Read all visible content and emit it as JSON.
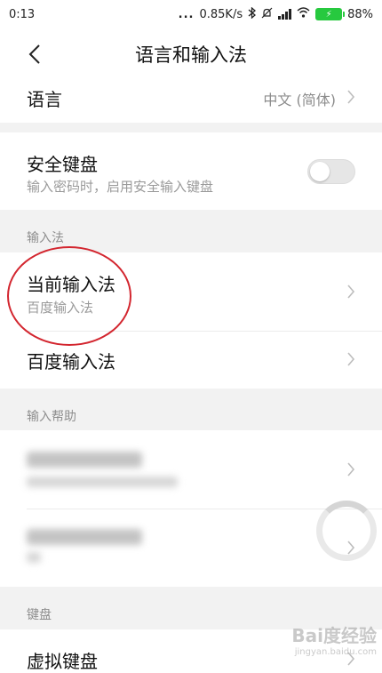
{
  "statusbar": {
    "time": "0:13",
    "dots": "...",
    "net_speed": "0.85K/s",
    "bluetooth": "bluetooth-icon",
    "silent": "silent-icon",
    "signal": "signal-icon",
    "wifi": "wifi-icon",
    "battery_percent": "88%"
  },
  "header": {
    "title": "语言和输入法",
    "back_icon": "chevron-left-icon"
  },
  "language": {
    "label": "语言",
    "value": "中文 (简体)"
  },
  "secure_keyboard": {
    "label": "安全键盘",
    "description": "输入密码时，启用安全输入键盘",
    "enabled": false
  },
  "input_methods": {
    "section_label": "输入法",
    "current": {
      "label": "当前输入法",
      "value": "百度输入法"
    },
    "baidu": {
      "label": "百度输入法"
    }
  },
  "input_help": {
    "section_label": "输入帮助"
  },
  "keyboard": {
    "section_label": "键盘",
    "virtual": {
      "label": "虚拟键盘"
    }
  },
  "watermark": {
    "logo": "Bai度经验",
    "url": "jingyan.baidu.com"
  },
  "colors": {
    "accent_annotation": "#d3262f",
    "background": "#f2f2f2",
    "card": "#ffffff"
  }
}
